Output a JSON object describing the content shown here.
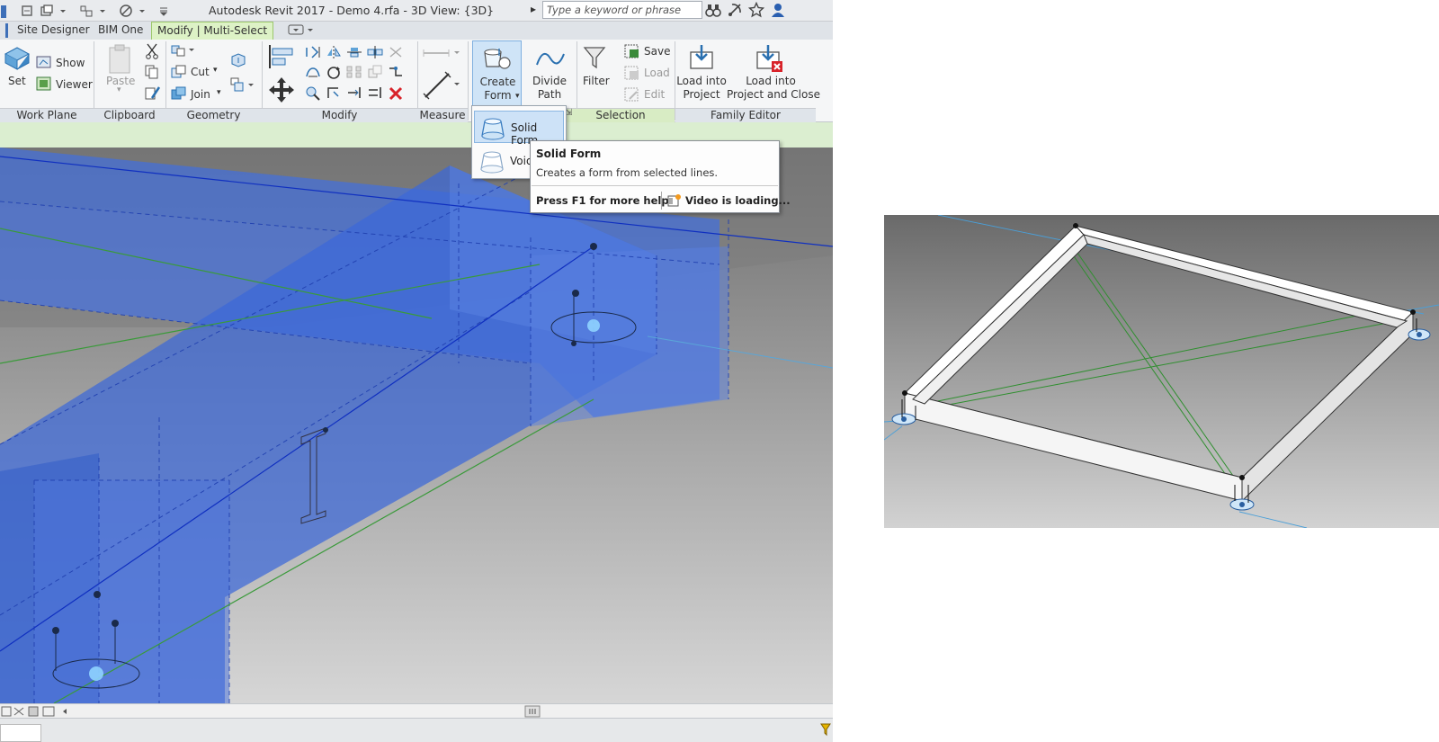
{
  "window": {
    "app_title": "Autodesk Revit 2017 -     Demo 4.rfa - 3D View: {3D}",
    "search_placeholder": "Type a keyword or phrase"
  },
  "tabs": [
    {
      "label": "Site Designer"
    },
    {
      "label": "BIM One"
    },
    {
      "label": "Modify | Multi-Select"
    }
  ],
  "ribbon": {
    "work_plane": {
      "panel": "Work Plane",
      "set": "Set",
      "show": "Show",
      "viewer": "Viewer"
    },
    "clipboard": {
      "panel": "Clipboard",
      "paste": "Paste"
    },
    "geometry": {
      "panel": "Geometry",
      "cut": "Cut",
      "join": "Join"
    },
    "modify": {
      "panel": "Modify"
    },
    "measure": {
      "panel": "Measure"
    },
    "form": {
      "create_form_line1": "Create",
      "create_form_line2": "Form",
      "divide_path_line1": "Divide",
      "divide_path_line2": "Path"
    },
    "selection": {
      "panel": "Selection",
      "filter": "Filter",
      "save": "Save",
      "load": "Load",
      "edit": "Edit"
    },
    "family_editor": {
      "panel": "Family Editor",
      "load_into_project_line1": "Load into",
      "load_into_project_line2": "Project",
      "load_close_line1": "Load into",
      "load_close_line2": "Project and Close"
    }
  },
  "dropdown": {
    "items": [
      {
        "label": "Solid Form"
      },
      {
        "label": "Void"
      }
    ]
  },
  "tooltip": {
    "title": "Solid Form",
    "description": "Creates a form from selected lines.",
    "help": "Press F1 for more help",
    "video": "Video is loading..."
  },
  "colors": {
    "selection_blue": "#2f5fe0",
    "active_tab": "#ddf2c6",
    "context_bar": "#dbeed0",
    "reference_line_green": "#3a9a3a"
  }
}
